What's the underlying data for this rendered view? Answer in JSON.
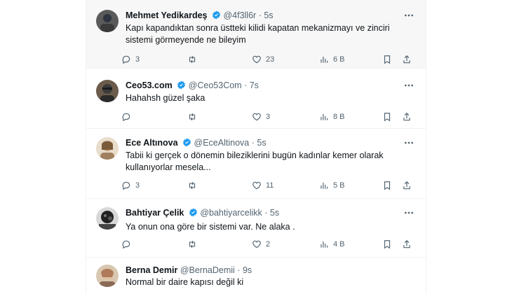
{
  "tweets": [
    {
      "name": "Mehmet Yedikardeş",
      "handle": "@4f3ll6r",
      "time": "5s",
      "text": "Kapı kapandıktan sonra üstteki kilidi kapatan mekanizmayı ve zinciri sistemi görmeyende ne bileyim",
      "replies": "3",
      "retweets": "",
      "likes": "23",
      "views": "6 B",
      "avatar_colors": [
        "#4a4a4a",
        "#2e3440"
      ]
    },
    {
      "name": "Ceo53.com",
      "handle": "@Ceo53Com",
      "time": "7s",
      "text": "Hahahsh güzel şaka",
      "replies": "",
      "retweets": "",
      "likes": "3",
      "views": "8 B",
      "avatar_colors": [
        "#3b3b3b",
        "#6b5b4b"
      ]
    },
    {
      "name": "Ece Altınova",
      "handle": "@EceAltinova",
      "time": "5s",
      "text": "Tabii ki gerçek o dönemin bileziklerini bugün kadınlar kemer olarak kullanıyorlar mesela...",
      "replies": "3",
      "retweets": "",
      "likes": "11",
      "views": "5 B",
      "avatar_colors": [
        "#c9a27a",
        "#7a5a3a"
      ]
    },
    {
      "name": "Bahtiyar Çelik",
      "handle": "@bahtiyarcelikk",
      "time": "5s",
      "text": "Ya onun ona göre bir sistemi var. Ne alaka .",
      "replies": "",
      "retweets": "",
      "likes": "2",
      "views": "4 B",
      "avatar_colors": [
        "#222222",
        "#777777"
      ]
    },
    {
      "name": "Berna Demir",
      "handle": "@BernaDemii",
      "time": "9s",
      "text": "Normal bir daire kapısı değil ki",
      "replies": "",
      "retweets": "",
      "likes": "",
      "views": "",
      "avatar_colors": [
        "#b07a5a",
        "#e0c0a0"
      ]
    }
  ],
  "theme": {
    "verified": "#1d9bf0",
    "muted": "#536471",
    "border": "#eff3f4"
  },
  "icons": {
    "reply": "reply-icon",
    "retweet": "retweet-icon",
    "like": "heart-icon",
    "views": "views-chart-icon",
    "bookmark": "bookmark-icon",
    "share": "share-icon",
    "more": "more-options-icon",
    "verified": "verified-badge-icon"
  }
}
